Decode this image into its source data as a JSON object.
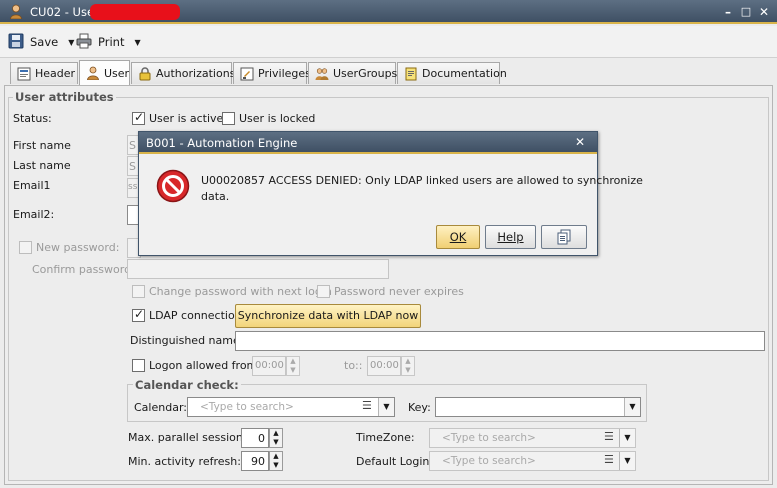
{
  "window": {
    "title": "CU02 - User:",
    "minimize": "–",
    "maximize": "□",
    "close": "✕"
  },
  "toolbar": {
    "save_label": "Save",
    "print_label": "Print"
  },
  "tabs": [
    {
      "label": "Header"
    },
    {
      "label": "User"
    },
    {
      "label": "Authorizations"
    },
    {
      "label": "Privileges"
    },
    {
      "label": "UserGroups"
    },
    {
      "label": "Documentation"
    }
  ],
  "user_attributes": {
    "legend": "User attributes",
    "status_label": "Status:",
    "active_label": "User is active",
    "locked_label": "User is locked",
    "first_name_label": "First name",
    "last_name_label": "Last name",
    "email1_label": "Email1",
    "email2_label": "Email2:",
    "first_name_value": "S",
    "last_name_value": "S",
    "email1_value": "ss",
    "new_password_label": "New password:",
    "confirm_password_label": "Confirm password:",
    "change_password_label": "Change password with next login",
    "never_expires_label": "Password never expires",
    "ldap_label": "LDAP connection",
    "sync_button": "Synchronize data with LDAP now",
    "distinguished_label": "Distinguished name:",
    "logon_label": "Logon allowed from:",
    "logon_from": "00:00",
    "logon_to_label": "to::",
    "logon_to": "00:00"
  },
  "calendar_check": {
    "legend": "Calendar check:",
    "calendar_label": "Calendar:",
    "calendar_placeholder": "<Type to search>",
    "key_label": "Key:"
  },
  "sessions": {
    "max_parallel_label": "Max. parallel sessions:",
    "max_parallel_value": "0",
    "min_activity_label": "Min. activity refresh:",
    "min_activity_value": "90",
    "timezone_label": "TimeZone:",
    "timezone_placeholder": "<Type to search>",
    "default_login_label": "Default Login:",
    "default_login_placeholder": "<Type to search>"
  },
  "dialog": {
    "title": "B001 - Automation Engine",
    "close": "✕",
    "message_line1": "U00020857 ACCESS DENIED: Only LDAP linked users are allowed to synchronize",
    "message_line2": "data.",
    "ok_label": "OK",
    "help_label": "Help"
  },
  "colors": {
    "title_bar": "#4e6075",
    "accent": "#d9b44a",
    "error_icon": "#d8282a"
  }
}
